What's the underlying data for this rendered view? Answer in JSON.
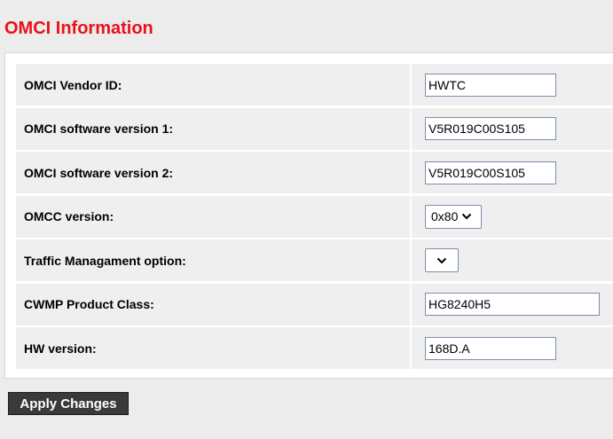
{
  "page": {
    "title": "OMCI Information"
  },
  "form": {
    "vendor_id": {
      "label": "OMCI Vendor ID:",
      "value": "HWTC"
    },
    "software_version_1": {
      "label": "OMCI software version 1:",
      "value": "V5R019C00S105"
    },
    "software_version_2": {
      "label": "OMCI software version 2:",
      "value": "V5R019C00S105"
    },
    "omcc_version": {
      "label": "OMCC version:",
      "selected": "0x80"
    },
    "traffic_management": {
      "label": "Traffic Managament option:",
      "selected": ""
    },
    "cwmp_product_class": {
      "label": "CWMP Product Class:",
      "value": "HG8240H5"
    },
    "hw_version": {
      "label": "HW version:",
      "value": "168D.A"
    }
  },
  "actions": {
    "apply_label": "Apply Changes"
  },
  "icons": {
    "select_arrow": "chevron-down-icon"
  },
  "colors": {
    "title": "#e8121a",
    "button_bg": "#3a3a3a",
    "row_bg": "#efefef",
    "page_bg": "#ececec"
  }
}
